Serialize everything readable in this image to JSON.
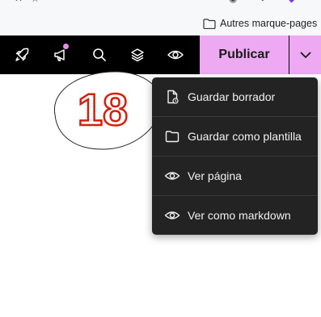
{
  "browser": {
    "bookmark_label": "Autres marque-pages"
  },
  "toolbar": {
    "icons": [
      "rocket-icon",
      "megaphone-icon",
      "search-icon",
      "layers-icon",
      "eye-icon"
    ],
    "notification_dot_color": "#e58ee9",
    "publish_label": "Publicar",
    "publish_color": "#eea9f3"
  },
  "annotation": {
    "number": "18",
    "color": "#d2200c"
  },
  "menu": {
    "items": [
      {
        "label": "Guardar borrador",
        "icon": "document-icon"
      },
      {
        "label": "Guardar como plantilla",
        "icon": "folder-icon"
      },
      {
        "label": "Ver página",
        "icon": "eye-icon"
      },
      {
        "label": "Ver como markdown",
        "icon": "eye-icon"
      }
    ]
  }
}
